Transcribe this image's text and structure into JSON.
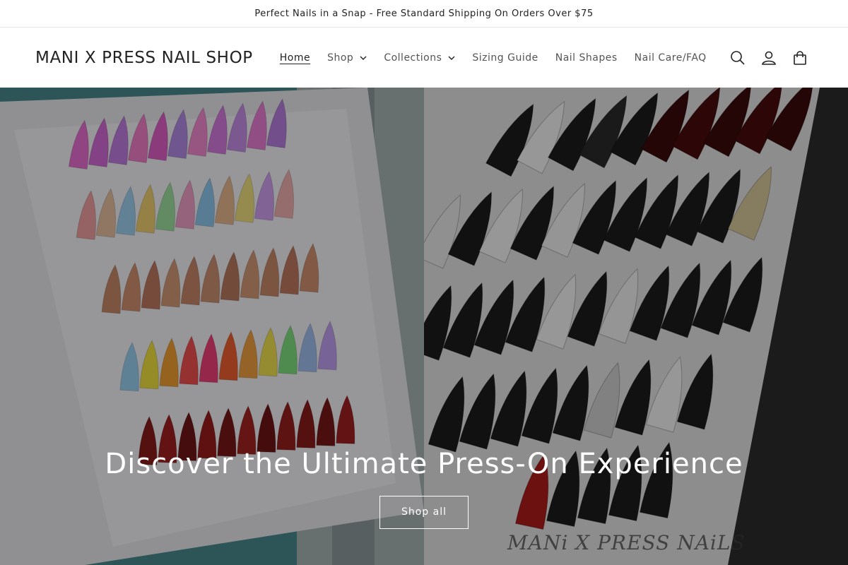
{
  "announcement": {
    "text": "Perfect Nails in a Snap - Free Standard Shipping On Orders Over $75"
  },
  "header": {
    "logo": "MANI X PRESS NAIL SHOP",
    "nav": [
      {
        "label": "Home",
        "active": true,
        "dropdown": false
      },
      {
        "label": "Shop",
        "active": false,
        "dropdown": true
      },
      {
        "label": "Collections",
        "active": false,
        "dropdown": true
      },
      {
        "label": "Sizing Guide",
        "active": false,
        "dropdown": false
      },
      {
        "label": "Nail Shapes",
        "active": false,
        "dropdown": false
      },
      {
        "label": "Nail Care/FAQ",
        "active": false,
        "dropdown": false
      }
    ],
    "icons": [
      "search-icon",
      "account-icon",
      "cart-icon"
    ]
  },
  "hero": {
    "title": "Discover the Ultimate Press-On Experience",
    "button": "Shop all",
    "watermark": "MANi X PRESS NAiLS"
  },
  "colors": {
    "text": "#222222",
    "overlay": "rgba(0,0,0,0.38)"
  }
}
